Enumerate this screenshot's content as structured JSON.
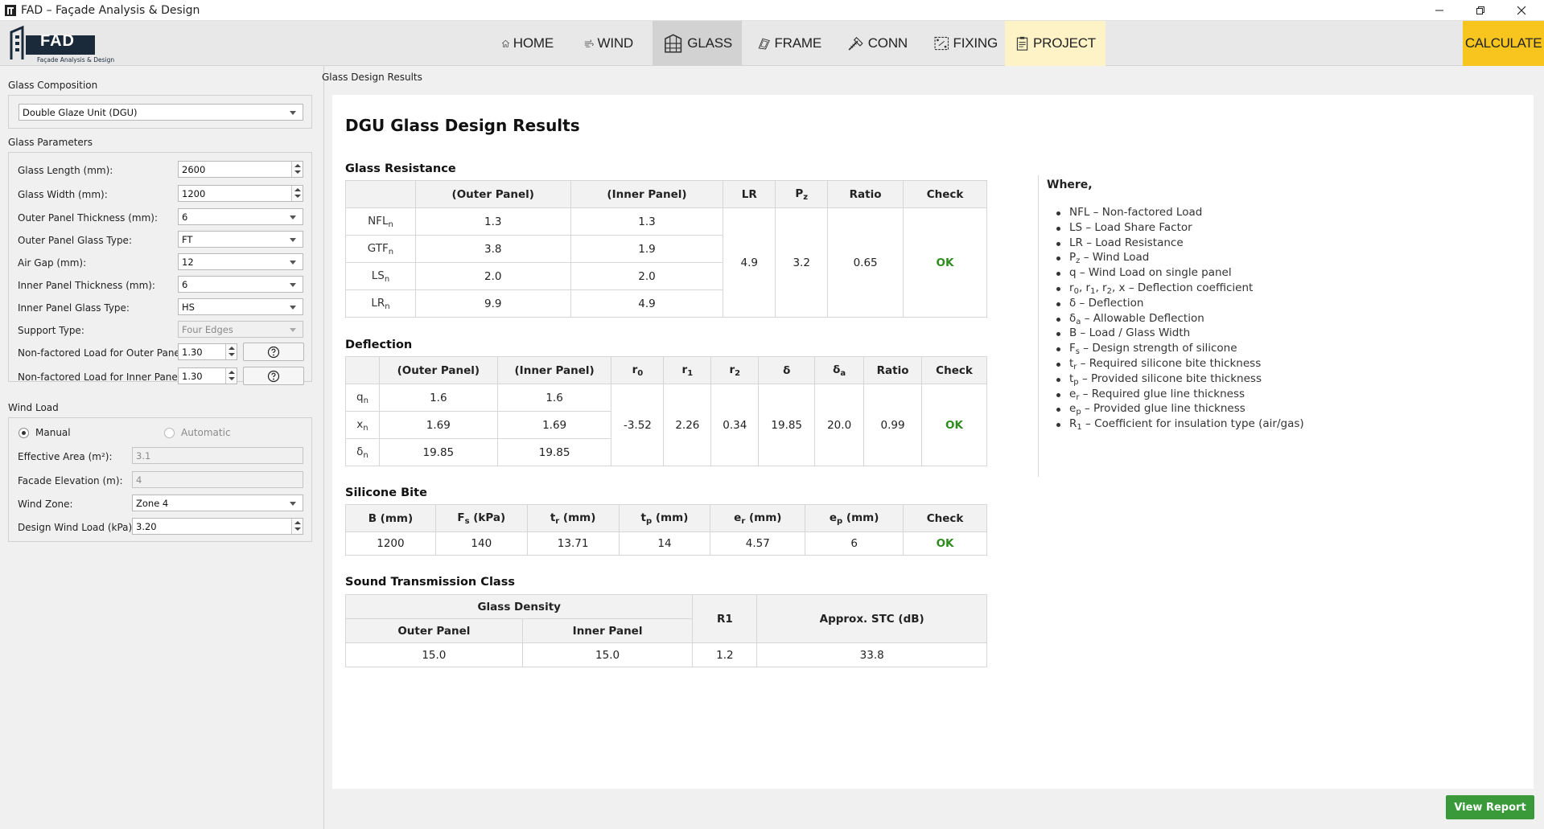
{
  "window": {
    "title": "FAD – Façade Analysis & Design",
    "controls": [
      "minimize-icon",
      "restore-icon",
      "close-icon"
    ]
  },
  "logo": {
    "text": "FAD",
    "subtitle": "Façade Analysis & Design"
  },
  "nav": {
    "items": [
      {
        "label": "HOME",
        "icon": "home-icon"
      },
      {
        "label": "WIND",
        "icon": "wind-icon"
      },
      {
        "label": "GLASS",
        "icon": "glass-icon",
        "active": true
      },
      {
        "label": "FRAME",
        "icon": "frame-icon"
      },
      {
        "label": "CONN",
        "icon": "screw-icon"
      },
      {
        "label": "FIXING",
        "icon": "fixing-icon"
      },
      {
        "label": "PROJECT",
        "icon": "project-icon"
      }
    ],
    "calculate_label": "CALCULATE",
    "colors": {
      "calculate": "#f7c51e",
      "project": "#fdf3c7",
      "active": "#d2d2d2"
    }
  },
  "left": {
    "composition": {
      "title": "Glass Composition",
      "value": "Double Glaze Unit (DGU)"
    },
    "params": {
      "title": "Glass Parameters",
      "glass_length": {
        "label": "Glass Length (mm):",
        "value": "2600"
      },
      "glass_width": {
        "label": "Glass Width (mm):",
        "value": "1200"
      },
      "outer_thickness": {
        "label": "Outer Panel Thickness (mm):",
        "value": "6"
      },
      "outer_type": {
        "label": "Outer Panel Glass Type:",
        "value": "FT"
      },
      "air_gap": {
        "label": "Air Gap (mm):",
        "value": "12"
      },
      "inner_thickness": {
        "label": "Inner Panel Thickness (mm):",
        "value": "6"
      },
      "inner_type": {
        "label": "Inner Panel Glass Type:",
        "value": "HS"
      },
      "support_type": {
        "label": "Support Type:",
        "value": "Four Edges"
      },
      "nfl_outer": {
        "label": "Non-factored Load for Outer Pane:",
        "value": "1.30"
      },
      "nfl_inner": {
        "label": "Non-factored Load for Inner Pane:",
        "value": "1.30"
      }
    },
    "wind": {
      "title": "Wind Load",
      "manual_label": "Manual",
      "automatic_label": "Automatic",
      "effective_area": {
        "label": "Effective Area (m²):",
        "value": "3.1"
      },
      "facade_elevation": {
        "label": "Facade Elevation (m):",
        "value": "4"
      },
      "wind_zone": {
        "label": "Wind Zone:",
        "value": "Zone 4"
      },
      "design_wind": {
        "label": "Design Wind Load (kPa):",
        "value": "3.20"
      }
    }
  },
  "results": {
    "header": "Glass Design Results",
    "title": "DGU Glass Design Results",
    "ok_color": "#2e8b1e",
    "resistance": {
      "title": "Glass Resistance",
      "col_outer": "(Outer Panel)",
      "col_inner": "(Inner Panel)",
      "col_lr": "LR",
      "col_pz": "P",
      "col_pz_sub": "z",
      "col_ratio": "Ratio",
      "col_check": "Check",
      "rows": [
        {
          "label": "NFL",
          "sub": "n",
          "outer": "1.3",
          "inner": "1.3"
        },
        {
          "label": "GTF",
          "sub": "n",
          "outer": "3.8",
          "inner": "1.9"
        },
        {
          "label": "LS",
          "sub": "n",
          "outer": "2.0",
          "inner": "2.0"
        },
        {
          "label": "LR",
          "sub": "n",
          "outer": "9.9",
          "inner": "4.9"
        }
      ],
      "lr": "4.9",
      "pz": "3.2",
      "ratio": "0.65",
      "check": "OK"
    },
    "deflection": {
      "title": "Deflection",
      "col_outer": "(Outer Panel)",
      "col_inner": "(Inner Panel)",
      "col_r0": "r",
      "col_r0_sub": "0",
      "col_r1": "r",
      "col_r1_sub": "1",
      "col_r2": "r",
      "col_r2_sub": "2",
      "col_d": "δ",
      "col_da": "δ",
      "col_da_sub": "a",
      "col_ratio": "Ratio",
      "col_check": "Check",
      "rows": [
        {
          "label": "q",
          "sub": "n",
          "outer": "1.6",
          "inner": "1.6"
        },
        {
          "label": "x",
          "sub": "n",
          "outer": "1.69",
          "inner": "1.69"
        },
        {
          "label": "δ",
          "sub": "n",
          "outer": "19.85",
          "inner": "19.85"
        }
      ],
      "r0": "-3.52",
      "r1": "2.26",
      "r2": "0.34",
      "d": "19.85",
      "da": "20.0",
      "ratio": "0.99",
      "check": "OK"
    },
    "silicone": {
      "title": "Silicone Bite",
      "cols": [
        {
          "label": "B (mm)"
        },
        {
          "label": "F",
          "sub": "s",
          "suffix": " (kPa)"
        },
        {
          "label": "t",
          "sub": "r",
          "suffix": " (mm)"
        },
        {
          "label": "t",
          "sub": "p",
          "suffix": " (mm)"
        },
        {
          "label": "e",
          "sub": "r",
          "suffix": " (mm)"
        },
        {
          "label": "e",
          "sub": "p",
          "suffix": " (mm)"
        },
        {
          "label": "Check"
        }
      ],
      "values": [
        "1200",
        "140",
        "13.71",
        "14",
        "4.57",
        "6"
      ],
      "check": "OK"
    },
    "stc": {
      "title": "Sound Transmission Class",
      "col_density": "Glass Density",
      "col_outer": "Outer Panel",
      "col_inner": "Inner Panel",
      "col_r1": "R1",
      "col_stc": "Approx. STC (dB)",
      "outer": "15.0",
      "inner": "15.0",
      "r1": "1.2",
      "stc": "33.8"
    },
    "where": {
      "title": "Where,",
      "items": [
        {
          "parts": [
            {
              "t": "NFL – Non-factored Load"
            }
          ]
        },
        {
          "parts": [
            {
              "t": "LS – Load Share Factor"
            }
          ]
        },
        {
          "parts": [
            {
              "t": "LR – Load Resistance"
            }
          ]
        },
        {
          "parts": [
            {
              "t": "P"
            },
            {
              "s": "z"
            },
            {
              "t": " – Wind Load"
            }
          ]
        },
        {
          "parts": [
            {
              "t": "q – Wind Load on single panel"
            }
          ]
        },
        {
          "parts": [
            {
              "t": "r"
            },
            {
              "s": "0"
            },
            {
              "t": ", r"
            },
            {
              "s": "1"
            },
            {
              "t": ", r"
            },
            {
              "s": "2"
            },
            {
              "t": ", x – Deflection coefficient"
            }
          ]
        },
        {
          "parts": [
            {
              "t": "δ – Deflection"
            }
          ]
        },
        {
          "parts": [
            {
              "t": "δ"
            },
            {
              "s": "a"
            },
            {
              "t": " – Allowable Deflection"
            }
          ]
        },
        {
          "parts": [
            {
              "t": "B – Load / Glass Width"
            }
          ]
        },
        {
          "parts": [
            {
              "t": "F"
            },
            {
              "s": "s"
            },
            {
              "t": " – Design strength of silicone"
            }
          ]
        },
        {
          "parts": [
            {
              "t": "t"
            },
            {
              "s": "r"
            },
            {
              "t": " – Required silicone bite thickness"
            }
          ]
        },
        {
          "parts": [
            {
              "t": "t"
            },
            {
              "s": "p"
            },
            {
              "t": " – Provided silicone bite thickness"
            }
          ]
        },
        {
          "parts": [
            {
              "t": "e"
            },
            {
              "s": "r"
            },
            {
              "t": " – Required glue line thickness"
            }
          ]
        },
        {
          "parts": [
            {
              "t": "e"
            },
            {
              "s": "p"
            },
            {
              "t": " – Provided glue line thickness"
            }
          ]
        },
        {
          "parts": [
            {
              "t": "R"
            },
            {
              "s": "1"
            },
            {
              "t": " – Coefficient for insulation type (air/gas)"
            }
          ]
        }
      ]
    },
    "view_report_label": "View Report"
  }
}
